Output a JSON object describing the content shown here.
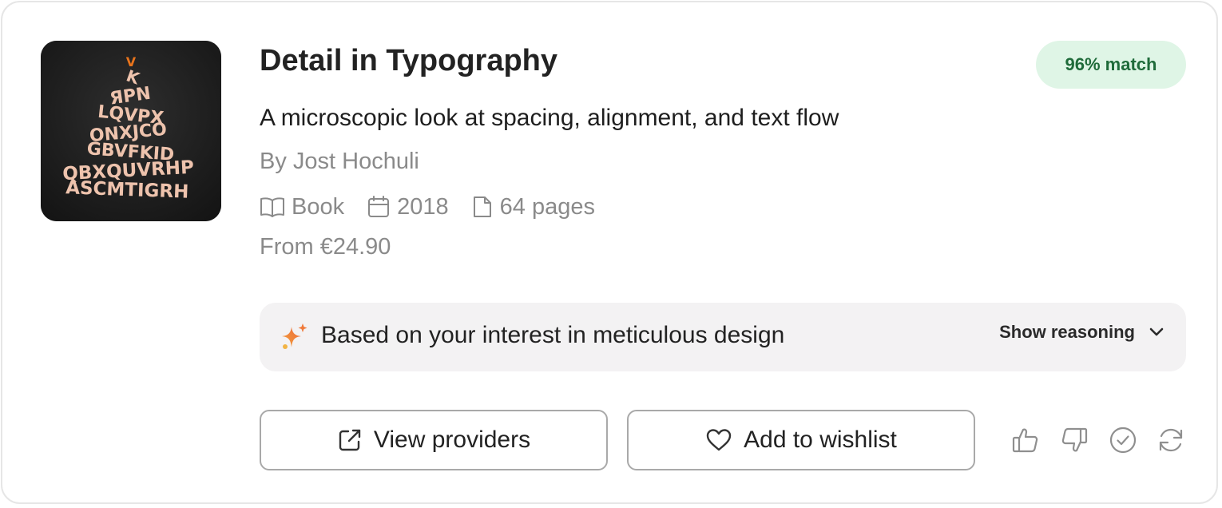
{
  "book": {
    "title": "Detail in Typography",
    "match": "96% match",
    "subtitle": "A microscopic look at spacing, alignment, and text flow",
    "author": "By Jost Hochuli",
    "format": "Book",
    "year": "2018",
    "pages": "64 pages",
    "price": "From €24.90",
    "cover_top_letter": "V"
  },
  "recommendation": {
    "reason": "Based on your interest in meticulous design",
    "show_reasoning_label": "Show reasoning"
  },
  "actions": {
    "view_providers_label": "View providers",
    "wishlist_label": "Add to wishlist"
  },
  "icons": {
    "format": "book-open-icon",
    "year": "calendar-icon",
    "pages": "file-icon",
    "reason": "sparkle-icon",
    "expand": "chevron-down-icon",
    "view_providers": "external-link-icon",
    "wishlist": "heart-icon",
    "feedback": [
      "thumbs-up-icon",
      "thumbs-down-icon",
      "check-circle-icon",
      "refresh-icon"
    ]
  },
  "colors": {
    "badge_bg": "#dff5e6",
    "badge_text": "#1f6b3a",
    "reason_bg": "#f3f2f3",
    "muted_text": "#8a8a8a",
    "cover_bg": "#1f1f1f",
    "cover_letters": "#eec3ad",
    "cover_accent": "#e8741c"
  }
}
